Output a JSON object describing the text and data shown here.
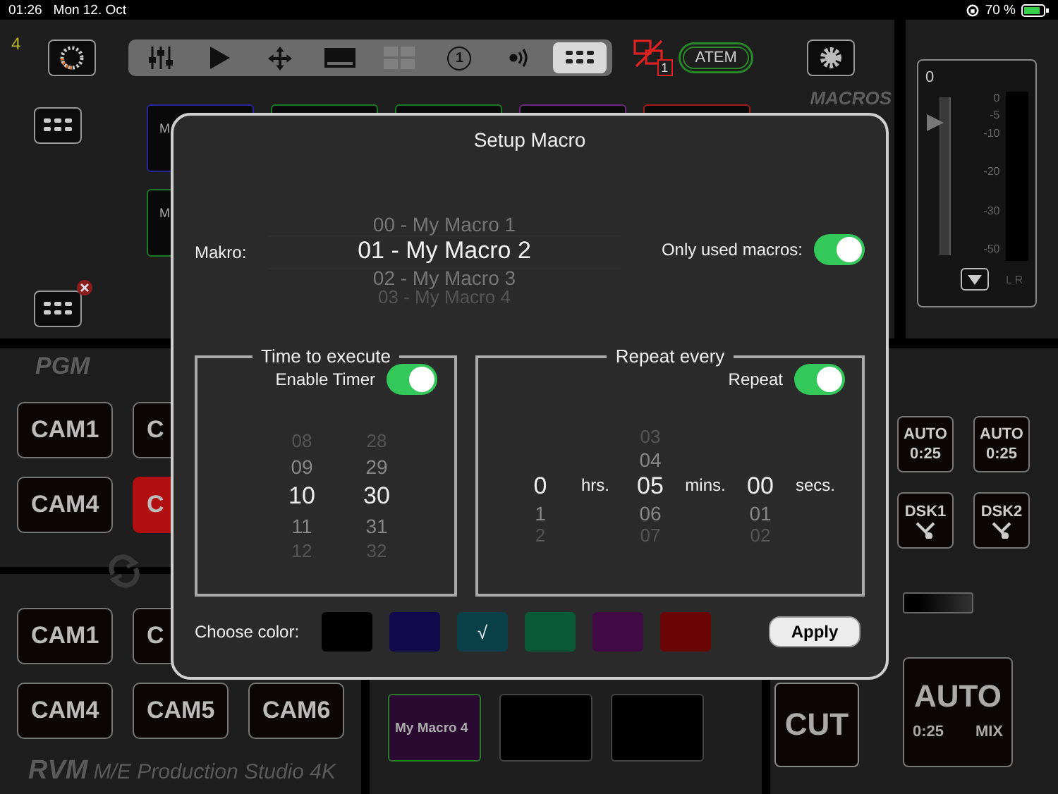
{
  "status_bar": {
    "time": "01:26",
    "date": "Mon 12. Oct",
    "battery": "70 %"
  },
  "top_bar": {
    "counter": "4",
    "alert_count": "1",
    "connection": "ATEM",
    "tools": [
      {
        "kind": "mixer",
        "selected": false,
        "disabled": false
      },
      {
        "kind": "play",
        "selected": false,
        "disabled": false
      },
      {
        "kind": "move",
        "selected": false,
        "disabled": false
      },
      {
        "kind": "screen",
        "selected": false,
        "disabled": false
      },
      {
        "kind": "multiview",
        "selected": false,
        "disabled": true
      },
      {
        "kind": "number",
        "label": "1",
        "selected": false,
        "disabled": false
      },
      {
        "kind": "audio",
        "selected": false,
        "disabled": false
      },
      {
        "kind": "keyboard",
        "selected": true,
        "disabled": false
      }
    ]
  },
  "macro_panel": {
    "title": "MACROS",
    "tiles": [
      {
        "label": "M",
        "color": "#26269a"
      },
      {
        "color": "#1e7a2a"
      },
      {
        "color": "#1e7a2a"
      },
      {
        "color": "#6a2a7a"
      },
      {
        "color": "#a01c1c"
      },
      {
        "label": "M",
        "color": "#1e7a2a"
      }
    ]
  },
  "audio_meter": {
    "value": "0",
    "level": 0.84,
    "scale": [
      "0",
      "-5",
      "-10",
      "-20",
      "-30",
      "-50"
    ],
    "channels": "L R"
  },
  "program": {
    "title": "PGM",
    "rows": [
      [
        {
          "label": "CAM1",
          "selected": false
        },
        {
          "label": "C",
          "selected": false
        }
      ],
      [
        {
          "label": "CAM4",
          "selected": false
        },
        {
          "label": "C",
          "selected": true
        }
      ]
    ]
  },
  "preview": {
    "rows": [
      [
        {
          "label": "CAM1",
          "selected": false
        },
        {
          "label": "C",
          "selected": false
        }
      ],
      [
        {
          "label": "CAM4",
          "selected": false
        },
        {
          "label": "CAM5",
          "selected": false
        },
        {
          "label": "CAM6",
          "selected": false
        }
      ]
    ]
  },
  "footer": {
    "brand": "RVM",
    "model": "M/E Production Studio 4K"
  },
  "macro_bar": [
    {
      "label": "My Macro 4",
      "color": "#2a0a30"
    },
    {
      "color": "#000000"
    },
    {
      "color": "#000000"
    }
  ],
  "transition": {
    "auto_buttons": [
      {
        "title": "AUTO",
        "time": "0:25"
      },
      {
        "title": "AUTO",
        "time": "0:25"
      }
    ],
    "keyers": [
      {
        "label": "DSK1"
      },
      {
        "label": "DSK2"
      }
    ],
    "cut": "CUT",
    "auto_mix": {
      "title": "AUTO",
      "time": "0:25",
      "mode": "MIX"
    }
  },
  "dialog": {
    "title": "Setup Macro",
    "macro_label": "Makro:",
    "macros": [
      {
        "label": "00 - My Macro 1",
        "selected": false
      },
      {
        "label": "01 - My Macro 2",
        "selected": true
      },
      {
        "label": "02 - My Macro 3",
        "selected": false
      },
      {
        "label": "03 - My Macro 4",
        "selected": false
      }
    ],
    "only_used": {
      "label": "Only used macros:",
      "on": true
    },
    "timer": {
      "title": "Time to execute",
      "toggle": {
        "label": "Enable Timer",
        "on": true
      },
      "columns": [
        {
          "items": [
            {
              "label": "08",
              "selected": false
            },
            {
              "label": "09",
              "selected": false
            },
            {
              "label": "10",
              "selected": true
            },
            {
              "label": "11",
              "selected": false
            },
            {
              "label": "12",
              "selected": false
            }
          ]
        },
        {
          "items": [
            {
              "label": "28",
              "selected": false
            },
            {
              "label": "29",
              "selected": false
            },
            {
              "label": "30",
              "selected": true
            },
            {
              "label": "31",
              "selected": false
            },
            {
              "label": "32",
              "selected": false
            }
          ]
        }
      ]
    },
    "repeat": {
      "title": "Repeat every",
      "toggle": {
        "label": "Repeat",
        "on": true
      },
      "columns": [
        {
          "unit": "hrs.",
          "items": [
            {
              "label": "0",
              "selected": true
            },
            {
              "label": "1",
              "selected": false
            },
            {
              "label": "2",
              "selected": false
            }
          ]
        },
        {
          "unit": "mins.",
          "items": [
            {
              "label": "03",
              "selected": false
            },
            {
              "label": "04",
              "selected": false
            },
            {
              "label": "05",
              "selected": true
            },
            {
              "label": "06",
              "selected": false
            },
            {
              "label": "07",
              "selected": false
            }
          ]
        },
        {
          "unit": "secs.",
          "items": [
            {
              "label": "00",
              "selected": true
            },
            {
              "label": "01",
              "selected": false
            },
            {
              "label": "02",
              "selected": false
            }
          ]
        }
      ]
    },
    "color_label": "Choose color:",
    "check_mark": "√",
    "colors": [
      {
        "color": "#000000",
        "selected": false
      },
      {
        "color": "#120a4a",
        "selected": false
      },
      {
        "color": "#0a4048",
        "selected": true
      },
      {
        "color": "#0a5a3a",
        "selected": false
      },
      {
        "color": "#400a44",
        "selected": false
      },
      {
        "color": "#6a0606",
        "selected": false
      }
    ],
    "apply": "Apply"
  }
}
